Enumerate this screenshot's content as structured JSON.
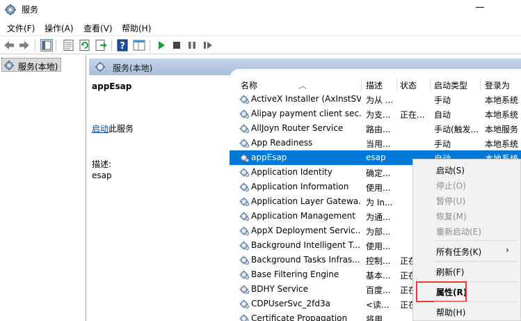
{
  "window": {
    "title": "服务",
    "icon": "gear-icon"
  },
  "menu": [
    "文件(F)",
    "操作(A)",
    "查看(V)",
    "帮助(H)"
  ],
  "toolbar": {
    "icons": [
      "back-arrow-icon",
      "forward-arrow-icon",
      "show-tree-icon",
      "list-view-icon",
      "refresh-icon",
      "export-list-icon",
      "help-icon",
      "properties-pane-icon",
      "start-service-icon",
      "stop-service-icon",
      "pause-service-icon",
      "restart-service-icon"
    ]
  },
  "tree": {
    "root_label": "服务(本地)"
  },
  "panel": {
    "header": "服务(本地)"
  },
  "detail": {
    "service_name": "appEsap",
    "start_link": "启动",
    "start_suffix": "此服务",
    "desc_label": "描述:",
    "desc_text": "esap"
  },
  "columns": {
    "name": "名称",
    "desc": "描述",
    "status": "状态",
    "startup": "启动类型",
    "logon": "登录为"
  },
  "rows": [
    {
      "name": "ActiveX Installer (AxInstSV)",
      "desc": "为从 ...",
      "status": "",
      "startup": "手动",
      "logon": "本地系统"
    },
    {
      "name": "Alipay payment client sec...",
      "desc": "为支...",
      "status": "正在...",
      "startup": "自动",
      "logon": "本地系统"
    },
    {
      "name": "AllJoyn Router Service",
      "desc": "路由...",
      "status": "",
      "startup": "手动(触发...",
      "logon": "本地服务"
    },
    {
      "name": "App Readiness",
      "desc": "当用...",
      "status": "",
      "startup": "手动",
      "logon": "本地系统"
    },
    {
      "name": "appEsap",
      "desc": "esap",
      "status": "",
      "startup": "自动",
      "logon": "本地系统"
    },
    {
      "name": "Application Identity",
      "desc": "确定...",
      "status": "",
      "startup": "",
      "logon": ""
    },
    {
      "name": "Application Information",
      "desc": "使用...",
      "status": "",
      "startup": "",
      "logon": ""
    },
    {
      "name": "Application Layer Gatewa...",
      "desc": "为 In...",
      "status": "",
      "startup": "",
      "logon": ""
    },
    {
      "name": "Application Management",
      "desc": "为通...",
      "status": "",
      "startup": "",
      "logon": ""
    },
    {
      "name": "AppX Deployment Servic...",
      "desc": "为部...",
      "status": "",
      "startup": "",
      "logon": ""
    },
    {
      "name": "Background Intelligent T...",
      "desc": "使用...",
      "status": "",
      "startup": "",
      "logon": ""
    },
    {
      "name": "Background Tasks Infras...",
      "desc": "控制...",
      "status": "正在",
      "startup": "",
      "logon": ""
    },
    {
      "name": "Base Filtering Engine",
      "desc": "基本...",
      "status": "正在",
      "startup": "",
      "logon": ""
    },
    {
      "name": "BDHY Service",
      "desc": "百度...",
      "status": "正在",
      "startup": "",
      "logon": ""
    },
    {
      "name": "CDPUserSvc_2fd3a",
      "desc": "<读...",
      "status": "正在",
      "startup": "",
      "logon": ""
    },
    {
      "name": "Certificate Propagation",
      "desc": "将用...",
      "status": "",
      "startup": "",
      "logon": ""
    }
  ],
  "selected_row": "appEsap",
  "context_menu": {
    "start": "启动(S)",
    "stop": "停止(O)",
    "pause": "暂停(U)",
    "resume": "恢复(M)",
    "restart": "重新启动(E)",
    "all_tasks": "所有任务(K)",
    "refresh": "刷新(F)",
    "properties": "属性(R)",
    "help": "帮助(H)"
  },
  "colors": {
    "selection": "#0078d7",
    "highlight_box": "#e53935",
    "panel_header": "#a9bfdc",
    "link": "#0645ad"
  }
}
